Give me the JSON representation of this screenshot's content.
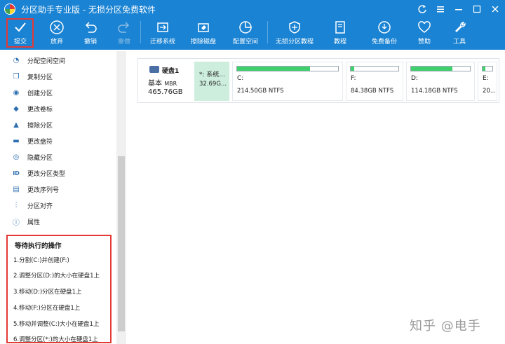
{
  "window": {
    "title": "分区助手专业版 - 无损分区免费软件"
  },
  "toolbar": {
    "items": [
      {
        "label": "提交",
        "icon": "check-icon"
      },
      {
        "label": "放弃",
        "icon": "cancel-icon"
      },
      {
        "label": "撤销",
        "icon": "undo-icon"
      },
      {
        "label": "重做",
        "icon": "redo-icon"
      },
      {
        "label": "迁移系统",
        "icon": "migrate-icon"
      },
      {
        "label": "擦除磁盘",
        "icon": "erase-icon"
      },
      {
        "label": "配置空间",
        "icon": "allocate-icon"
      },
      {
        "label": "无损分区教程",
        "icon": "shield-icon"
      },
      {
        "label": "教程",
        "icon": "book-icon"
      },
      {
        "label": "免费备份",
        "icon": "backup-icon"
      },
      {
        "label": "赞助",
        "icon": "heart-icon"
      },
      {
        "label": "工具",
        "icon": "wrench-icon"
      }
    ]
  },
  "sidebar": {
    "items": [
      {
        "label": "分配空闲空间",
        "icon": "allocate-icon"
      },
      {
        "label": "复制分区",
        "icon": "copy-icon"
      },
      {
        "label": "创建分区",
        "icon": "create-icon"
      },
      {
        "label": "更改卷标",
        "icon": "tag-icon"
      },
      {
        "label": "擦除分区",
        "icon": "wipe-icon"
      },
      {
        "label": "更改盘符",
        "icon": "letter-icon"
      },
      {
        "label": "隐藏分区",
        "icon": "eye-icon"
      },
      {
        "label": "更改分区类型",
        "icon": "id-icon"
      },
      {
        "label": "更改序列号",
        "icon": "serial-icon"
      },
      {
        "label": "分区对齐",
        "icon": "align-icon"
      },
      {
        "label": "属性",
        "icon": "info-icon"
      }
    ]
  },
  "pending": {
    "title": "等待执行的操作",
    "ops": [
      "1.分割(C:)并创建(F:)",
      "2.调整分区(D:)的大小在硬盘1上",
      "3.移动(D:)分区在硬盘1上",
      "4.移动(F:)分区在硬盘1上",
      "5.移动并调整(C:)大小在硬盘1上",
      "6.调整分区(*:)的大小在硬盘1上"
    ]
  },
  "disk": {
    "name": "硬盘1",
    "type": "基本",
    "scheme": "MBR",
    "size": "465.76GB",
    "partitions": [
      {
        "name": "*: 系统...",
        "detail": "32.69G...",
        "fill": 0.0,
        "selected": true
      },
      {
        "name": "C:",
        "detail": "214.50GB NTFS",
        "fill": 0.72,
        "selected": false
      },
      {
        "name": "F:",
        "detail": "84.38GB NTFS",
        "fill": 0.08,
        "selected": false
      },
      {
        "name": "D:",
        "detail": "114.18GB NTFS",
        "fill": 0.7,
        "selected": false
      },
      {
        "name": "E:",
        "detail": "20...",
        "fill": 0.3,
        "selected": false
      }
    ]
  },
  "watermark": "知乎 @电手",
  "colors": {
    "accent": "#1a83d3",
    "highlight": "#e53935",
    "used_space": "#3fcf6d"
  }
}
